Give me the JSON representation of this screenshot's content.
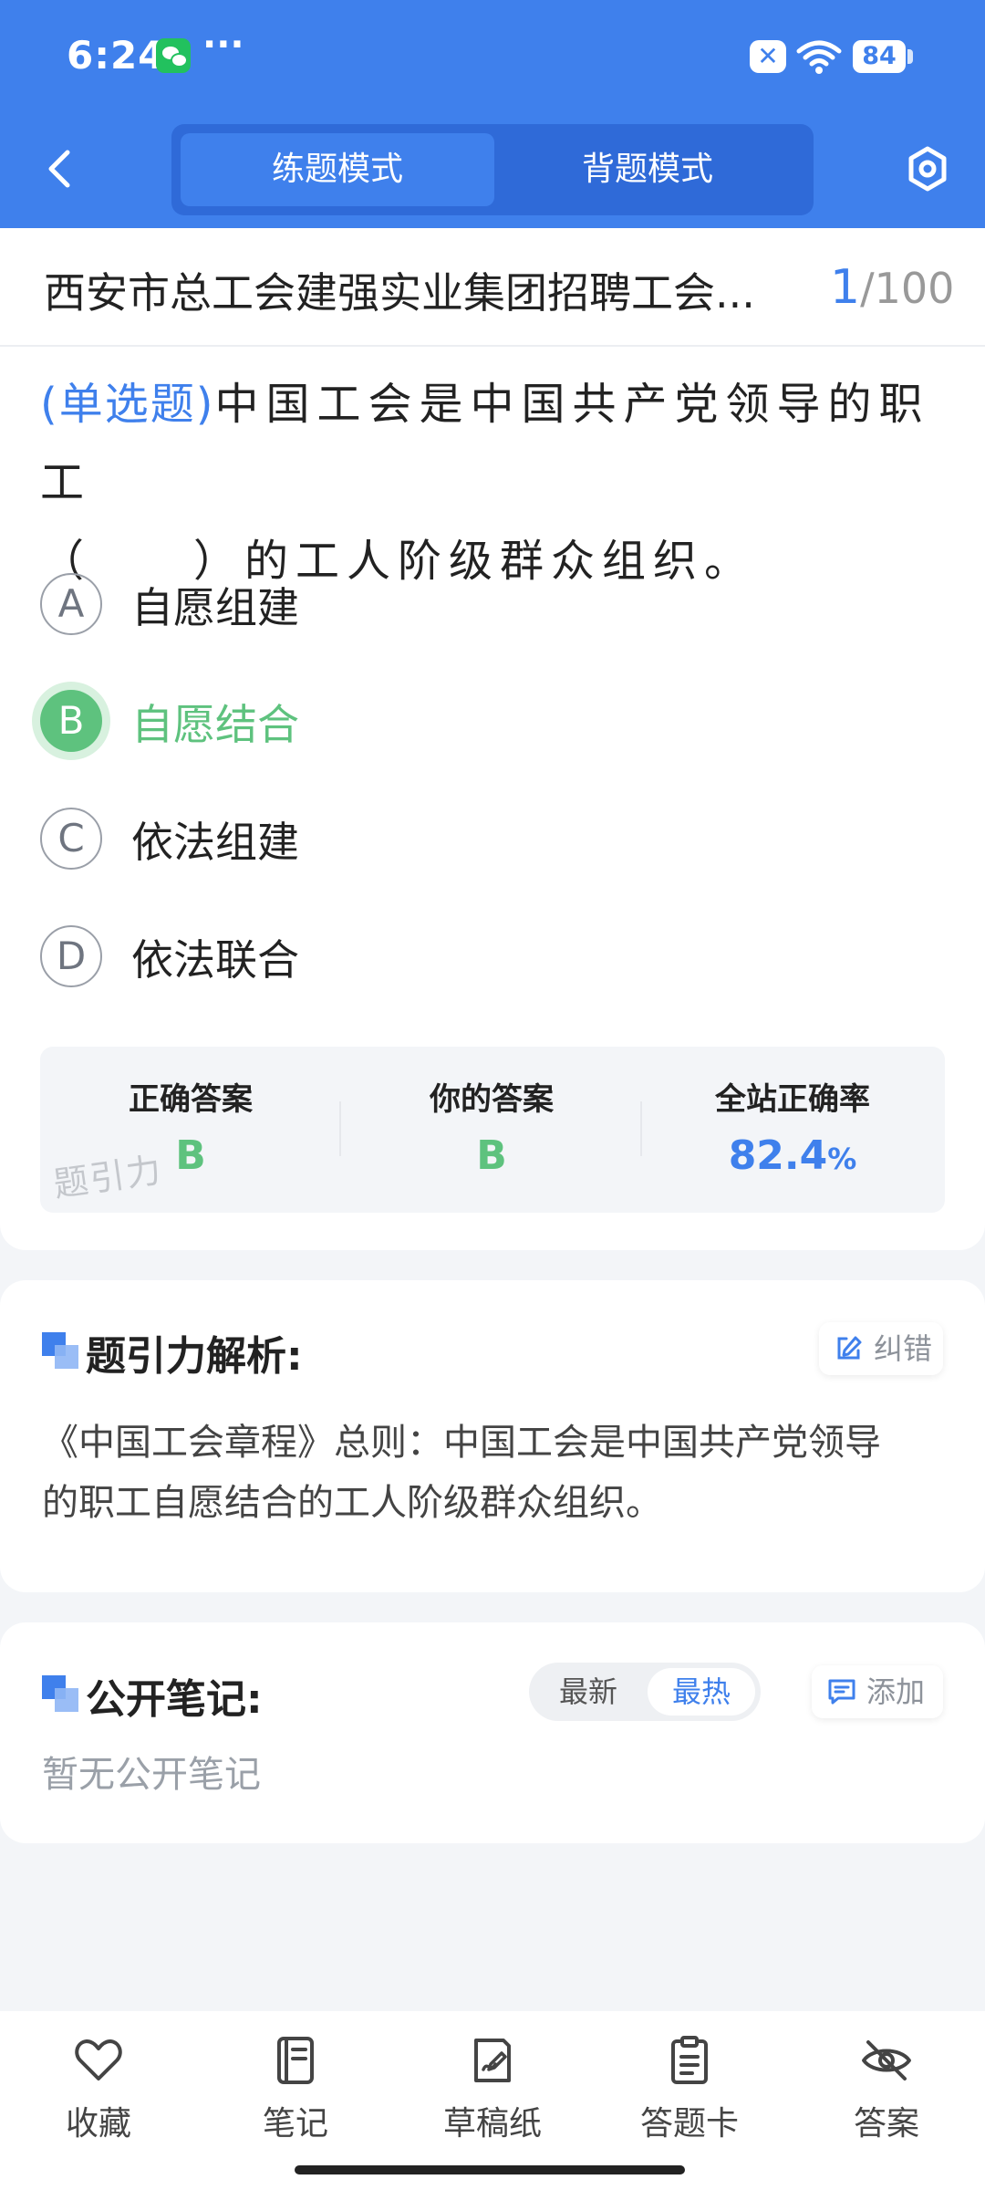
{
  "status_bar": {
    "time": "6:24",
    "more": "···",
    "battery": "84"
  },
  "header": {
    "tabs": [
      {
        "label": "练题模式",
        "active": true
      },
      {
        "label": "背题模式",
        "active": false
      }
    ]
  },
  "question": {
    "title": "西安市总工会建强实业集团招聘工会...",
    "current": "1",
    "total": "/100",
    "type": "(单选题)",
    "text_line1": "中国工会是中国共产党领导的职工",
    "text_line2": "（　　）的工人阶级群众组织。",
    "options": [
      {
        "letter": "A",
        "text": "自愿组建",
        "selected": false
      },
      {
        "letter": "B",
        "text": "自愿结合",
        "selected": true
      },
      {
        "letter": "C",
        "text": "依法组建",
        "selected": false
      },
      {
        "letter": "D",
        "text": "依法联合",
        "selected": false
      }
    ]
  },
  "result": {
    "correct_label": "正确答案",
    "correct_value": "B",
    "your_label": "你的答案",
    "your_value": "B",
    "rate_label": "全站正确率",
    "rate_value": "82.4",
    "rate_unit": "%",
    "watermark": "题引力"
  },
  "analysis": {
    "title": "题引力解析:",
    "report_label": "纠错",
    "line1": "《中国工会章程》总则：中国工会是中国共产党领导",
    "line2": "的职工自愿结合的工人阶级群众组织。"
  },
  "notes": {
    "title": "公开笔记:",
    "sort_newest": "最新",
    "sort_hottest": "最热",
    "add_label": "添加",
    "empty_text": "暂无公开笔记"
  },
  "bottom_nav": [
    {
      "label": "收藏",
      "icon": "heart-icon"
    },
    {
      "label": "笔记",
      "icon": "notebook-icon"
    },
    {
      "label": "草稿纸",
      "icon": "draft-icon"
    },
    {
      "label": "答题卡",
      "icon": "clipboard-icon"
    },
    {
      "label": "答案",
      "icon": "eye-off-icon"
    }
  ],
  "colors": {
    "primary": "#3f80ec",
    "correct": "#5ec27e",
    "text": "#222222",
    "muted": "#9aa0a8"
  }
}
